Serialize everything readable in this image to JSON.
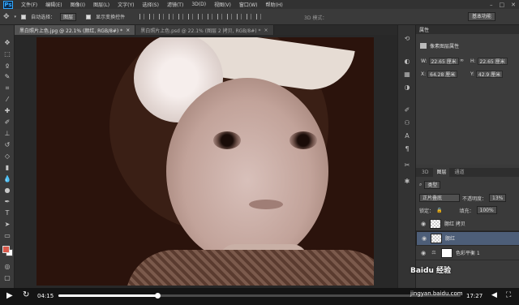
{
  "menubar": {
    "logo": "Ps",
    "items": [
      "文件(F)",
      "编辑(E)",
      "图像(I)",
      "图层(L)",
      "文字(Y)",
      "选择(S)",
      "滤镜(T)",
      "3D(D)",
      "视图(V)",
      "窗口(W)",
      "帮助(H)"
    ]
  },
  "options": {
    "auto_select_label": "自动选择：",
    "auto_select_value": "图层",
    "show_transform_label": "显示变换控件",
    "mode_3d_label": "3D 模式：",
    "workspace": "基本功能"
  },
  "tabs": [
    {
      "label": "黑白照片上色.jpg @ 22.1% (颜红, RGB/8#) *",
      "close": "×"
    },
    {
      "label": "黑白照片上色.psd @ 22.1% (图层 2 拷贝, RGB/8#) *",
      "close": "×"
    }
  ],
  "properties": {
    "header": "属性",
    "title": "像素图层属性",
    "w_label": "W:",
    "w_value": "22.65 厘米",
    "h_label": "H:",
    "h_value": "22.65 厘米",
    "x_label": "X:",
    "x_value": "64.28 厘米",
    "y_label": "Y:",
    "y_value": "42.9 厘米"
  },
  "layers": {
    "tab_3d": "3D",
    "tab_layers": "图层",
    "tab_channels": "通道",
    "kind_label": "类型",
    "blend_mode": "正片叠底",
    "opacity_label": "不透明度：",
    "opacity_value": "13%",
    "lock_label": "锁定：",
    "fill_label": "填充：",
    "fill_value": "100%",
    "rows": [
      {
        "name": "腮红 拷贝"
      },
      {
        "name": "腮红"
      },
      {
        "name": "色彩平衡 1"
      }
    ]
  },
  "player": {
    "current_time": "04:15",
    "total_time": "17:27",
    "progress": 0.245
  },
  "watermark": {
    "brand": "Baidu 经验",
    "url": "jingyan.baidu.com"
  }
}
